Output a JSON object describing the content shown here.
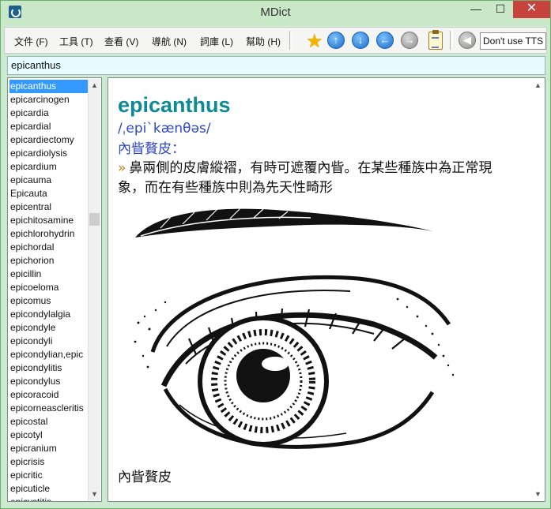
{
  "window": {
    "title": "MDict"
  },
  "menu": [
    "文件 (F)",
    "工具 (T)",
    "查看 (V)",
    "導航 (N)",
    "詞庫 (L)",
    "幫助 (H)"
  ],
  "toolbar": {
    "favorite_icon": "star-icon",
    "up_icon": "arrow-up-icon",
    "down_icon": "arrow-down-icon",
    "back_icon": "arrow-left-icon",
    "forward_icon": "arrow-right-icon",
    "clipboard_icon": "clipboard-icon",
    "speaker_icon": "speaker-icon",
    "tts_value": "Don't use TTS"
  },
  "search": {
    "value": "epicanthus"
  },
  "word_list": [
    "epicanthus",
    "epicarcinogen",
    "epicardia",
    "epicardial",
    "epicardiectomy",
    "epicardiolysis",
    "epicardium",
    "epicauma",
    "Epicauta",
    "epicentral",
    "epichitosamine",
    "epichlorohydrin",
    "epichordal",
    "epichorion",
    "epicillin",
    "epicoeloma",
    "epicomus",
    "epicondylalgia",
    "epicondyle",
    "epicondyli",
    "epicondylian,epic",
    "epicondylitis",
    "epicondylus",
    "epicoracoid",
    "epicorneascleritis",
    "epicostal",
    "epicotyl",
    "epicranium",
    "epicrisis",
    "epicritic",
    "epicuticle",
    "epicystitis"
  ],
  "selected_index": 0,
  "entry": {
    "headword": "epicanthus",
    "phonetic": "/ˌepiˋkænθəs/",
    "pos": "內眥贅皮：",
    "arrow": "»",
    "definition": "鼻兩側的皮膚縱褶，有時可遮覆內眥。在某些種族中為正常現象，而在有些種族中則為先天性畸形",
    "caption": "內眥贅皮"
  }
}
